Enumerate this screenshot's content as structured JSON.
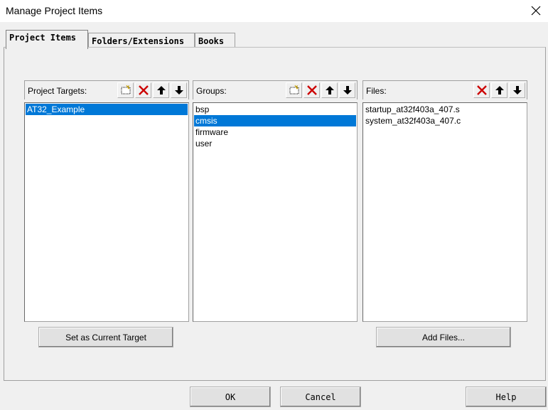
{
  "window": {
    "title": "Manage Project Items"
  },
  "tabs": [
    {
      "label": "Project Items",
      "active": true
    },
    {
      "label": "Folders/Extensions",
      "active": false
    },
    {
      "label": "Books",
      "active": false
    }
  ],
  "targets": {
    "label": "Project Targets:",
    "items": [
      {
        "name": "AT32_Example",
        "selected": true
      }
    ],
    "button": "Set as Current Target"
  },
  "groups": {
    "label": "Groups:",
    "items": [
      {
        "name": "bsp",
        "selected": false
      },
      {
        "name": "cmsis",
        "selected": true
      },
      {
        "name": "firmware",
        "selected": false
      },
      {
        "name": "user",
        "selected": false
      }
    ]
  },
  "files": {
    "label": "Files:",
    "items": [
      {
        "name": "startup_at32f403a_407.s",
        "selected": false
      },
      {
        "name": "system_at32f403a_407.c",
        "selected": false
      }
    ],
    "button": "Add Files..."
  },
  "footer": {
    "ok": "OK",
    "cancel": "Cancel",
    "help": "Help"
  },
  "icons": {
    "new": "new-item-icon",
    "delete": "delete-icon",
    "up": "move-up-icon",
    "down": "move-down-icon",
    "close": "close-icon"
  },
  "colors": {
    "selection": "#0078d7",
    "delete_red": "#cc0000"
  }
}
